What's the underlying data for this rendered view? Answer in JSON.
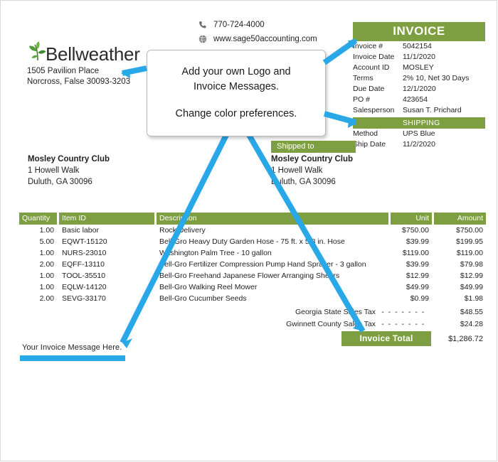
{
  "company": {
    "logo_icon": "leaf-sprout-icon",
    "name": "Bellweather",
    "address_line1": "1505 Pavilion Place",
    "address_line2": "Norcross, False 30093-3203",
    "phone_icon": "phone-icon",
    "phone": "770-724-4000",
    "web_icon": "globe-icon",
    "website": "www.sage50accounting.com"
  },
  "invoice": {
    "title": "INVOICE",
    "fields": [
      {
        "label": "Invoice #",
        "value": "5042154"
      },
      {
        "label": "Invoice Date",
        "value": "11/1/2020"
      },
      {
        "label": "Account ID",
        "value": "MOSLEY"
      },
      {
        "label": "Terms",
        "value": "2% 10, Net 30 Days"
      },
      {
        "label": "Due Date",
        "value": "12/1/2020"
      },
      {
        "label": "PO #",
        "value": "423654"
      },
      {
        "label": "Salesperson",
        "value": "Susan T. Prichard"
      }
    ],
    "shipping_title": "SHIPPING",
    "shipping_fields": [
      {
        "label": "Method",
        "value": "UPS Blue"
      },
      {
        "label": "Ship Date",
        "value": "11/2/2020"
      }
    ]
  },
  "bill_to": {
    "name": "Mosley Country Club",
    "line1": "1 Howell Walk",
    "line2": "Duluth, GA 30096"
  },
  "ship_to": {
    "tag": "Shipped to",
    "name": "Mosley Country Club",
    "line1": "1 Howell Walk",
    "line2": "Duluth, GA 30096"
  },
  "table": {
    "headers": {
      "quantity": "Quantity",
      "item_id": "Item ID",
      "description": "Description",
      "unit": "Unit",
      "amount": "Amount"
    },
    "rows": [
      {
        "quantity": "1.00",
        "item_id": "Basic labor",
        "description": "Rock Delivery",
        "unit": "$750.00",
        "amount": "$750.00"
      },
      {
        "quantity": "5.00",
        "item_id": "EQWT-15120",
        "description": "Bell-Gro Heavy Duty Garden Hose - 75 ft. x 5/8 in. Hose",
        "unit": "$39.99",
        "amount": "$199.95"
      },
      {
        "quantity": "1.00",
        "item_id": "NURS-23010",
        "description": "Washington Palm Tree - 10 gallon",
        "unit": "$119.00",
        "amount": "$119.00"
      },
      {
        "quantity": "2.00",
        "item_id": "EQFF-13110",
        "description": "Bell-Gro Fertilizer Compression Pump Hand Sprayer - 3 gallon",
        "unit": "$39.99",
        "amount": "$79.98"
      },
      {
        "quantity": "1.00",
        "item_id": "TOOL-35510",
        "description": "Bell-Gro Freehand Japanese Flower Arranging Shears",
        "unit": "$12.99",
        "amount": "$12.99"
      },
      {
        "quantity": "1.00",
        "item_id": "EQLW-14120",
        "description": "Bell-Gro Walking Reel Mower",
        "unit": "$49.99",
        "amount": "$49.99"
      },
      {
        "quantity": "2.00",
        "item_id": "SEVG-33170",
        "description": "Bell-Gro Cucumber Seeds",
        "unit": "$0.99",
        "amount": "$1.98"
      }
    ]
  },
  "totals": {
    "taxes": [
      {
        "label": "Georgia State Sales Tax",
        "dots": "- - - - - - -",
        "amount": "$48.55"
      },
      {
        "label": "Gwinnett County Sales Tax",
        "dots": "- - - - - - -",
        "amount": "$24.28"
      }
    ],
    "total_label": "Invoice Total",
    "total_amount": "$1,286.72"
  },
  "invoice_message": "Your Invoice Message Here.",
  "callout": {
    "line1": "Add your own Logo and",
    "line2": "Invoice Messages.",
    "line3": "Change color preferences."
  },
  "colors": {
    "accent_green": "#7e9f41",
    "arrow_blue": "#29a8e8",
    "text": "#231f20"
  }
}
